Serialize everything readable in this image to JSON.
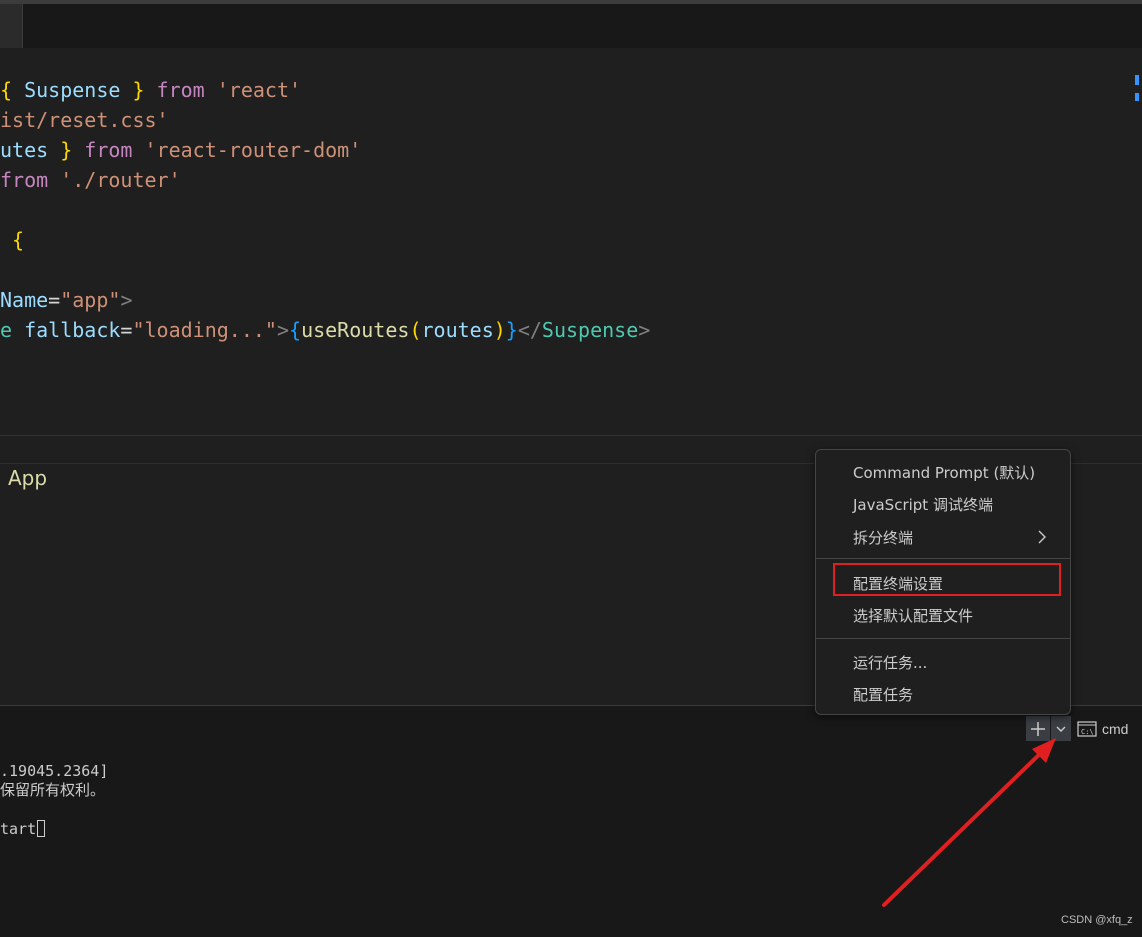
{
  "editor": {
    "lines": [
      {
        "segments": [
          {
            "text": "{",
            "cls": "br1"
          },
          {
            "text": " Suspense ",
            "cls": "var"
          },
          {
            "text": "}",
            "cls": "br1"
          },
          {
            "text": " from ",
            "cls": "kw"
          },
          {
            "text": "'react'",
            "cls": "str"
          }
        ]
      },
      {
        "segments": [
          {
            "text": "ist/reset.css'",
            "cls": "str"
          }
        ]
      },
      {
        "segments": [
          {
            "text": "utes ",
            "cls": "var"
          },
          {
            "text": "}",
            "cls": "br1"
          },
          {
            "text": " from ",
            "cls": "kw"
          },
          {
            "text": "'react-router-dom'",
            "cls": "str"
          }
        ]
      },
      {
        "segments": [
          {
            "text": "from ",
            "cls": "kw"
          },
          {
            "text": "'./router'",
            "cls": "str"
          }
        ]
      },
      {
        "segments": []
      },
      {
        "segments": [
          {
            "text": " {",
            "cls": "br1"
          }
        ]
      },
      {
        "segments": []
      },
      {
        "segments": [
          {
            "text": "Name",
            "cls": "attr"
          },
          {
            "text": "=",
            "cls": "white"
          },
          {
            "text": "\"app\"",
            "cls": "str"
          },
          {
            "text": ">",
            "cls": "pun"
          }
        ]
      },
      {
        "segments": [
          {
            "text": "e ",
            "cls": "tag"
          },
          {
            "text": "fallback",
            "cls": "attr"
          },
          {
            "text": "=",
            "cls": "white"
          },
          {
            "text": "\"loading...\"",
            "cls": "str"
          },
          {
            "text": ">",
            "cls": "pun"
          },
          {
            "text": "{",
            "cls": "br3"
          },
          {
            "text": "useRoutes",
            "cls": "fn"
          },
          {
            "text": "(",
            "cls": "br1"
          },
          {
            "text": "routes",
            "cls": "var"
          },
          {
            "text": ")",
            "cls": "br1"
          },
          {
            "text": "}",
            "cls": "br3"
          },
          {
            "text": "</",
            "cls": "pun"
          },
          {
            "text": "Suspense",
            "cls": "tag"
          },
          {
            "text": ">",
            "cls": "pun"
          }
        ]
      }
    ]
  },
  "outline": {
    "item": "App"
  },
  "terminal": {
    "lines": [
      ".19045.2364]",
      "保留所有权利。",
      "",
      "tart"
    ],
    "profile_label": "cmd",
    "colors": {
      "toolbar_button_bg": "#3a3d41",
      "background": "#181818"
    }
  },
  "menu": {
    "group1": [
      "Command Prompt (默认)",
      "JavaScript 调试终端",
      "拆分终端"
    ],
    "group2": [
      "配置终端设置",
      "选择默认配置文件"
    ],
    "group3": [
      "运行任务...",
      "配置任务"
    ],
    "submenu_arrow": "›"
  },
  "annotation": {
    "highlight_color": "#e02020",
    "arrow_color": "#e02020"
  },
  "watermark": "CSDN @xfq_z"
}
